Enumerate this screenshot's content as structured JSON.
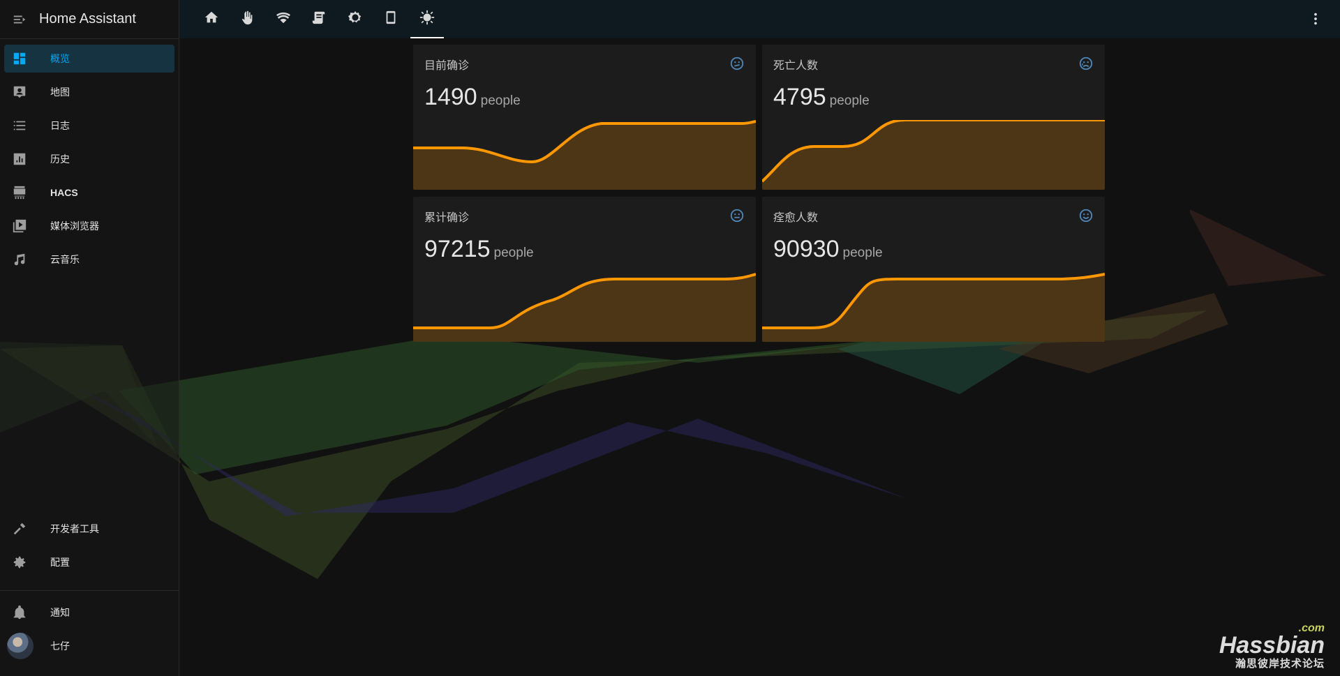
{
  "app": {
    "title": "Home Assistant"
  },
  "sidebar": {
    "items": [
      {
        "label": "概览",
        "icon": "dashboard-icon",
        "active": true
      },
      {
        "label": "地图",
        "icon": "map-account-icon"
      },
      {
        "label": "日志",
        "icon": "format-list-bulleted-icon"
      },
      {
        "label": "历史",
        "icon": "chart-box-icon"
      },
      {
        "label": "HACS",
        "icon": "hacs-icon"
      },
      {
        "label": "媒体浏览器",
        "icon": "play-box-multiple-icon"
      },
      {
        "label": "云音乐",
        "icon": "music-note-icon"
      }
    ],
    "bottom_items": [
      {
        "label": "开发者工具",
        "icon": "hammer-icon"
      },
      {
        "label": "配置",
        "icon": "gear-icon"
      }
    ],
    "notifications": {
      "label": "通知",
      "icon": "bell-icon"
    },
    "user": {
      "name": "七仔",
      "icon": "avatar"
    }
  },
  "toolbar": {
    "tabs": [
      {
        "icon": "home-icon"
      },
      {
        "icon": "hand-icon"
      },
      {
        "icon": "wifi-icon"
      },
      {
        "icon": "script-icon"
      },
      {
        "icon": "settings-icon"
      },
      {
        "icon": "tablet-icon"
      },
      {
        "icon": "virus-icon",
        "active": true
      }
    ],
    "more_icon": "dots-vertical-icon"
  },
  "cards": [
    {
      "title": "目前确诊",
      "value": "1490",
      "unit": "people",
      "icon": "emoticon-confused-icon"
    },
    {
      "title": "死亡人数",
      "value": "4795",
      "unit": "people",
      "icon": "emoticon-cry-icon"
    },
    {
      "title": "累计确诊",
      "value": "97215",
      "unit": "people",
      "icon": "emoticon-neutral-icon"
    },
    {
      "title": "痊愈人数",
      "value": "90930",
      "unit": "people",
      "icon": "emoticon-happy-icon"
    }
  ],
  "watermark": {
    "com": ".com",
    "name": "Hassbian",
    "sub": "瀚思彼岸技术论坛"
  },
  "colors": {
    "accent": "#03a9f4",
    "spark": "#ff9800",
    "icon": "#4f87b9"
  }
}
